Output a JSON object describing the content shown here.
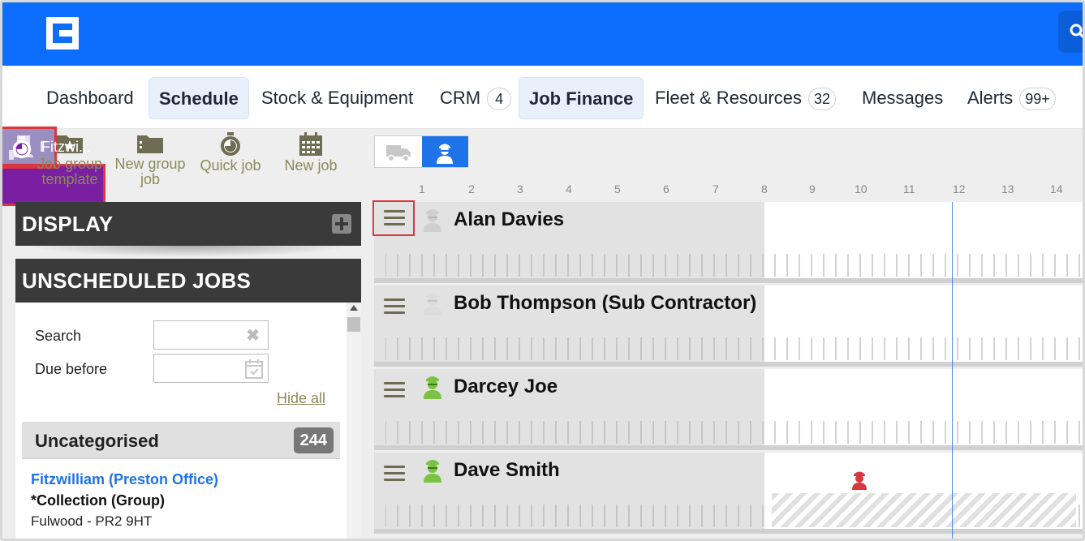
{
  "nav": {
    "items": [
      {
        "label": "Dashboard"
      },
      {
        "label": "Schedule"
      },
      {
        "label": "Stock & Equipment"
      },
      {
        "label": "CRM",
        "badge": "4"
      },
      {
        "label": "Job Finance"
      },
      {
        "label": "Fleet & Resources",
        "badge": "32"
      },
      {
        "label": "Messages"
      },
      {
        "label": "Alerts",
        "badge": "99+"
      }
    ]
  },
  "toolbar": {
    "job_group_template": "Job group template",
    "new_group_job": "New group job",
    "quick_job": "Quick job",
    "new_job": "New job"
  },
  "panels": {
    "display": "DISPLAY",
    "unscheduled_jobs": "UNSCHEDULED JOBS"
  },
  "filters": {
    "search_label": "Search",
    "search_value": "",
    "due_before_label": "Due before",
    "due_before_value": "",
    "hide_all": "Hide all"
  },
  "category": {
    "label": "Uncategorised",
    "count": "244"
  },
  "job": {
    "client": "Fitzwilliam (Preston Office)",
    "type": "*Collection (Group)",
    "location": "Fulwood - PR2 9HT"
  },
  "schedule": {
    "days": [
      "1",
      "2",
      "3",
      "4",
      "5",
      "6",
      "7",
      "8",
      "9",
      "10",
      "11",
      "12",
      "13",
      "14"
    ],
    "rows": [
      {
        "name": "Alan Davies",
        "status": "inactive"
      },
      {
        "name": "Bob Thompson (Sub Contractor)",
        "status": "inactive"
      },
      {
        "name": "Darcey Joe",
        "status": "active"
      },
      {
        "name": "Dave Smith",
        "status": "active"
      }
    ],
    "blocks": [
      {
        "label": "F"
      },
      {
        "label": "Fitzwi..."
      }
    ]
  },
  "colors": {
    "brand": "#0d6efd",
    "link": "#1e73e8",
    "accent_olive": "#8c8a5a",
    "job_purple": "#7b1fa2",
    "highlight_red": "#d9363e"
  },
  "icons": {
    "logo": "app-logo-icon",
    "search": "search-icon",
    "folder_star": "folder-star-icon",
    "folder": "folder-icon",
    "stopwatch": "stopwatch-icon",
    "calendar": "calendar-icon",
    "plus": "plus-icon",
    "clear": "clear-icon",
    "menu": "hamburger-menu-icon",
    "person": "person-icon",
    "truck": "truck-icon"
  }
}
